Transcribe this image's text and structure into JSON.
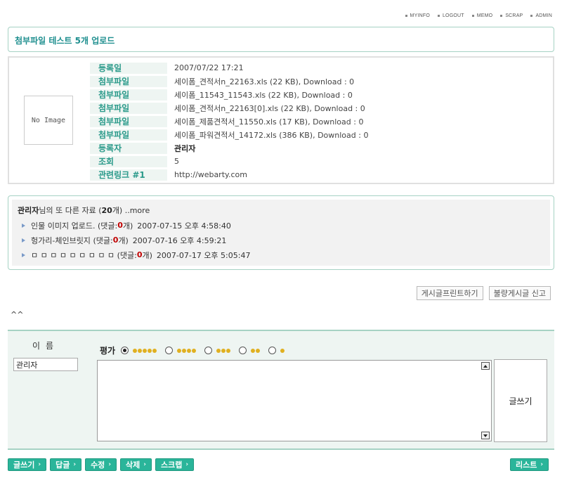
{
  "topnav": [
    "MYINFO",
    "LOGOUT",
    "MEMO",
    "SCRAP",
    "ADMIN"
  ],
  "post": {
    "title": "첨부파일 테스트 5개 업로드",
    "image_placeholder": "No Image",
    "rows": [
      {
        "label": "등록일",
        "value": "2007/07/22 17:21",
        "bold": false
      },
      {
        "label": "첨부파일",
        "value": "세이폼_견적서n_22163.xls (22 KB), Download : 0",
        "bold": false
      },
      {
        "label": "첨부파일",
        "value": "세이폼_11543_11543.xls (22 KB), Download : 0",
        "bold": false
      },
      {
        "label": "첨부파일",
        "value": "세이폼_견적서n_22163[0].xls (22 KB), Download : 0",
        "bold": false
      },
      {
        "label": "첨부파일",
        "value": "세이폼_제품견적서_11550.xls (17 KB), Download : 0",
        "bold": false
      },
      {
        "label": "첨부파일",
        "value": "세이폼_파워견적서_14172.xls (386 KB), Download : 0",
        "bold": false
      },
      {
        "label": "등록자",
        "value": "관리자",
        "bold": true
      },
      {
        "label": "조회",
        "value": "5",
        "bold": false
      },
      {
        "label": "관련링크 #1",
        "value": "http://webarty.com",
        "bold": false
      }
    ]
  },
  "others": {
    "author": "관리자",
    "text_mid": "님의 또 다른 자료 (",
    "count": "20",
    "text_end": "개) ..more",
    "items": [
      {
        "title": "인물 이미지 업로드.",
        "comment_pre": "(댓글: ",
        "comments": "0",
        "comment_post": "개)",
        "date": "2007-07-15 오후 4:58:40"
      },
      {
        "title": "헝가리-체인브릿지",
        "comment_pre": "(댓글: ",
        "comments": "0",
        "comment_post": "개)",
        "date": "2007-07-16 오후 4:59:21"
      },
      {
        "title": "ㅁ ㅁ ㅁ ㅁ ㅁ ㅁ ㅁ ㅁ ㅁ",
        "comment_pre": "(댓글: ",
        "comments": "0",
        "comment_post": "개)",
        "date": "2007-07-17 오후 5:05:47"
      }
    ]
  },
  "actions": {
    "print": "게시글프린트하기",
    "report": "불량게시글 신고"
  },
  "caret_text": "^^",
  "comment": {
    "name_label": "이름",
    "name_value": "관리자",
    "rating_label": "평가",
    "rating_options": [
      5,
      4,
      3,
      2,
      1
    ],
    "rating_selected": 5,
    "submit_label": "글쓰기"
  },
  "bottom_buttons": [
    "글쓰기",
    "답글",
    "수정",
    "삭제",
    "스크랩"
  ],
  "list_button": "리스트",
  "colors": {
    "accent": "#2ab59a",
    "border": "#a6d2c4",
    "label_bg": "#eef5f2",
    "label_text": "#2a9a8a",
    "comment_count": "#c00000"
  }
}
